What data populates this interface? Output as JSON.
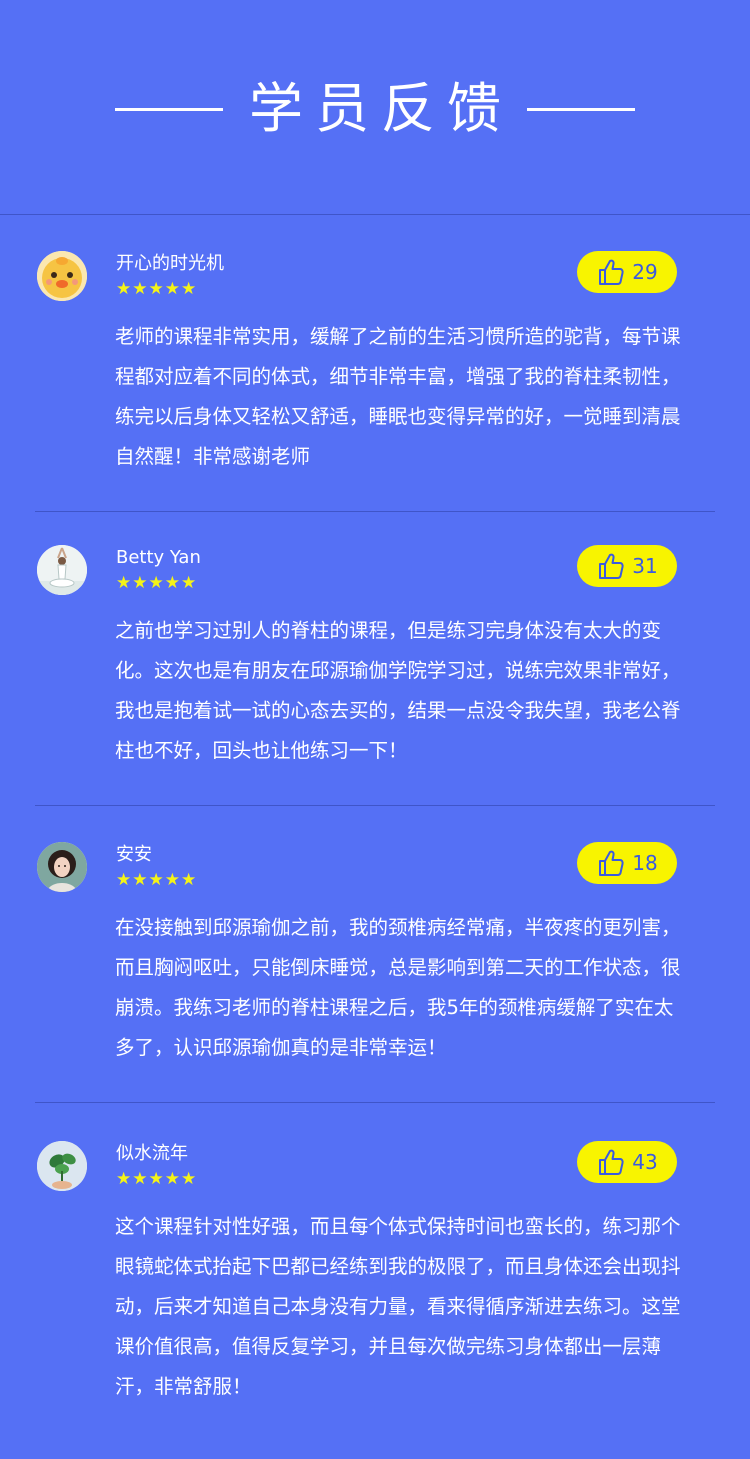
{
  "page_title": "学员反馈",
  "colors": {
    "background": "#5570f5",
    "like_badge": "#f8f400",
    "like_text": "#3b5be0",
    "stars": "#f4f318",
    "divider": "#3f55c9"
  },
  "reviews": [
    {
      "name": "开心的时光机",
      "stars": "★★★★★",
      "likes": "29",
      "avatar_icon": "cartoon-chick-avatar",
      "text": "老师的课程非常实用，缓解了之前的生活习惯所造的驼背，每节课程都对应着不同的体式，细节非常丰富，增强了我的脊柱柔韧性，练完以后身体又轻松又舒适，睡眠也变得异常的好，一觉睡到清晨自然醒！非常感谢老师"
    },
    {
      "name": "Betty Yan",
      "stars": "★★★★★",
      "likes": "31",
      "avatar_icon": "yoga-pose-avatar",
      "text": "之前也学习过别人的脊柱的课程，但是练习完身体没有太大的变化。这次也是有朋友在邱源瑜伽学院学习过，说练完效果非常好，我也是抱着试一试的心态去买的，结果一点没令我失望，我老公脊柱也不好，回头也让他练习一下！"
    },
    {
      "name": "安安",
      "stars": "★★★★★",
      "likes": "18",
      "avatar_icon": "woman-portrait-avatar",
      "text": "在没接触到邱源瑜伽之前，我的颈椎病经常痛，半夜疼的更列害，而且胸闷呕吐，只能倒床睡觉，总是影响到第二天的工作状态，很崩溃。我练习老师的脊柱课程之后，我5年的颈椎病缓解了实在太多了，认识邱源瑜伽真的是非常幸运！"
    },
    {
      "name": "似水流年",
      "stars": "★★★★★",
      "likes": "43",
      "avatar_icon": "plant-leaf-avatar",
      "text": "这个课程针对性好强，而且每个体式保持时间也蛮长的，练习那个眼镜蛇体式抬起下巴都已经练到我的极限了，而且身体还会出现抖动，后来才知道自己本身没有力量，看来得循序渐进去练习。这堂课价值很高，值得反复学习，并且每次做完练习身体都出一层薄汗，非常舒服！"
    }
  ]
}
